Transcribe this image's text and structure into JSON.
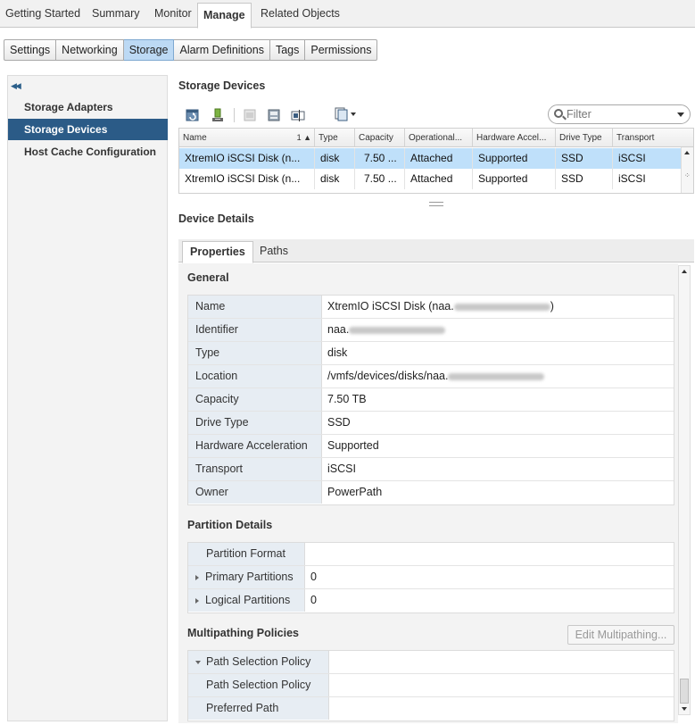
{
  "top_tabs": [
    {
      "label": "Getting Started"
    },
    {
      "label": "Summary"
    },
    {
      "label": "Monitor"
    },
    {
      "label": "Manage"
    },
    {
      "label": "Related Objects"
    }
  ],
  "sub_tabs": [
    {
      "label": "Settings"
    },
    {
      "label": "Networking"
    },
    {
      "label": "Storage"
    },
    {
      "label": "Alarm Definitions"
    },
    {
      "label": "Tags"
    },
    {
      "label": "Permissions"
    }
  ],
  "leftnav": {
    "items": [
      {
        "label": "Storage Adapters"
      },
      {
        "label": "Storage Devices"
      },
      {
        "label": "Host Cache Configuration"
      }
    ]
  },
  "storage_devices": {
    "title": "Storage Devices",
    "filter_placeholder": "Filter",
    "columns": [
      "Name",
      "Type",
      "Capacity",
      "Operational...",
      "Hardware Accel...",
      "Drive Type",
      "Transport"
    ],
    "sort_indicator": "1 ▲",
    "rows": [
      [
        "XtremIO iSCSI Disk (n...",
        "disk",
        "7.50 ...",
        "Attached",
        "Supported",
        "SSD",
        "iSCSI"
      ],
      [
        "XtremIO iSCSI Disk (n...",
        "disk",
        "7.50 ...",
        "Attached",
        "Supported",
        "SSD",
        "iSCSI"
      ]
    ]
  },
  "device_details": {
    "title": "Device Details",
    "tabs": [
      {
        "label": "Properties"
      },
      {
        "label": "Paths"
      }
    ],
    "general": {
      "title": "General",
      "rows": [
        {
          "key": "Name",
          "value": "XtremIO iSCSI Disk (naa.",
          "suffix": ")"
        },
        {
          "key": "Identifier",
          "value": "naa."
        },
        {
          "key": "Type",
          "value": "disk"
        },
        {
          "key": "Location",
          "value": "/vmfs/devices/disks/naa."
        },
        {
          "key": "Capacity",
          "value": "7.50 TB"
        },
        {
          "key": "Drive Type",
          "value": "SSD"
        },
        {
          "key": "Hardware Acceleration",
          "value": "Supported"
        },
        {
          "key": "Transport",
          "value": "iSCSI"
        },
        {
          "key": "Owner",
          "value": "PowerPath"
        }
      ]
    },
    "partition_details": {
      "title": "Partition Details",
      "rows": [
        {
          "key": "Partition Format",
          "value": ""
        },
        {
          "key": "Primary Partitions",
          "value": "0"
        },
        {
          "key": "Logical Partitions",
          "value": "0"
        }
      ]
    },
    "multipathing": {
      "title": "Multipathing Policies",
      "button_label": "Edit Multipathing...",
      "rows": [
        {
          "key": "Path Selection Policy",
          "value": ""
        },
        {
          "key": "Path Selection Policy",
          "value": ""
        },
        {
          "key": "Preferred Path",
          "value": ""
        }
      ]
    }
  },
  "colors": {
    "selected_nav": "#2b5b87",
    "selected_row": "#bfe0fa",
    "active_subtab": "#bcd9f4"
  }
}
